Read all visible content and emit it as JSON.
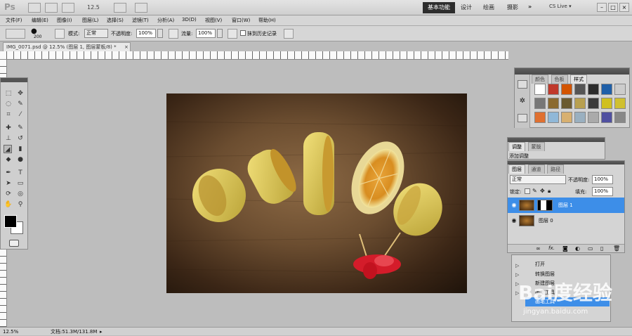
{
  "app": {
    "logo": "Ps",
    "zoom_select": "12.5",
    "workspace": "基本功能",
    "workspaces": [
      "设计",
      "绘画",
      "摄影"
    ],
    "more": "»",
    "cslive": "CS Live ▾"
  },
  "menu": [
    "文件(F)",
    "编辑(E)",
    "图像(I)",
    "图层(L)",
    "选择(S)",
    "滤镜(T)",
    "分析(A)",
    "3D(D)",
    "视图(V)",
    "窗口(W)",
    "帮助(H)"
  ],
  "options": {
    "brush_size": "200",
    "mode_label": "模式:",
    "mode_value": "正常",
    "opacity_label": "不透明度:",
    "opacity_value": "100%",
    "flow_label": "流量:",
    "flow_value": "100%",
    "history_checkbox": "抹到历史记录"
  },
  "document": {
    "tab": "IMG_0071.psd @ 12.5% (图层 1, 图层蒙板/8) *",
    "close": "×"
  },
  "swatches_panel": {
    "tabs": [
      "颜色",
      "色板",
      "样式"
    ],
    "swatch_colors": [
      "#ffffff",
      "#c0392b",
      "#d35400",
      "#555555",
      "#2c2c2c",
      "#1f5fa8",
      "#cccccc",
      "#777777",
      "#8b6a2f",
      "#6a5a30",
      "#b8a050",
      "#3a3a3a",
      "#d0c020",
      "#d0c030",
      "#e07030",
      "#90b8d8",
      "#d8b070",
      "#9ab0c0",
      "#aaaaaa",
      "#5050a0",
      "#888888"
    ]
  },
  "adjust_panel": {
    "tabs": [
      "调整",
      "蒙版"
    ],
    "title": "添加调整"
  },
  "layers_panel": {
    "tabs": [
      "图层",
      "通道",
      "路径"
    ],
    "blend_mode": "正常",
    "opacity_label": "不透明度:",
    "opacity_value": "100%",
    "lock_label": "锁定:",
    "fill_label": "填充:",
    "fill_value": "100%",
    "layers": [
      {
        "name": "图层 1",
        "selected": true
      },
      {
        "name": "图层 0",
        "selected": false
      }
    ]
  },
  "history_panel": {
    "items": [
      "打开",
      "转换图层",
      "新建图层",
      "画笔工具",
      "画笔工具"
    ]
  },
  "status": {
    "zoom": "12.5%",
    "doc_info": "文档:51.3M/131.8M"
  },
  "watermark": {
    "logo": "Bai度经验",
    "url": "jingyan.baidu.com"
  }
}
